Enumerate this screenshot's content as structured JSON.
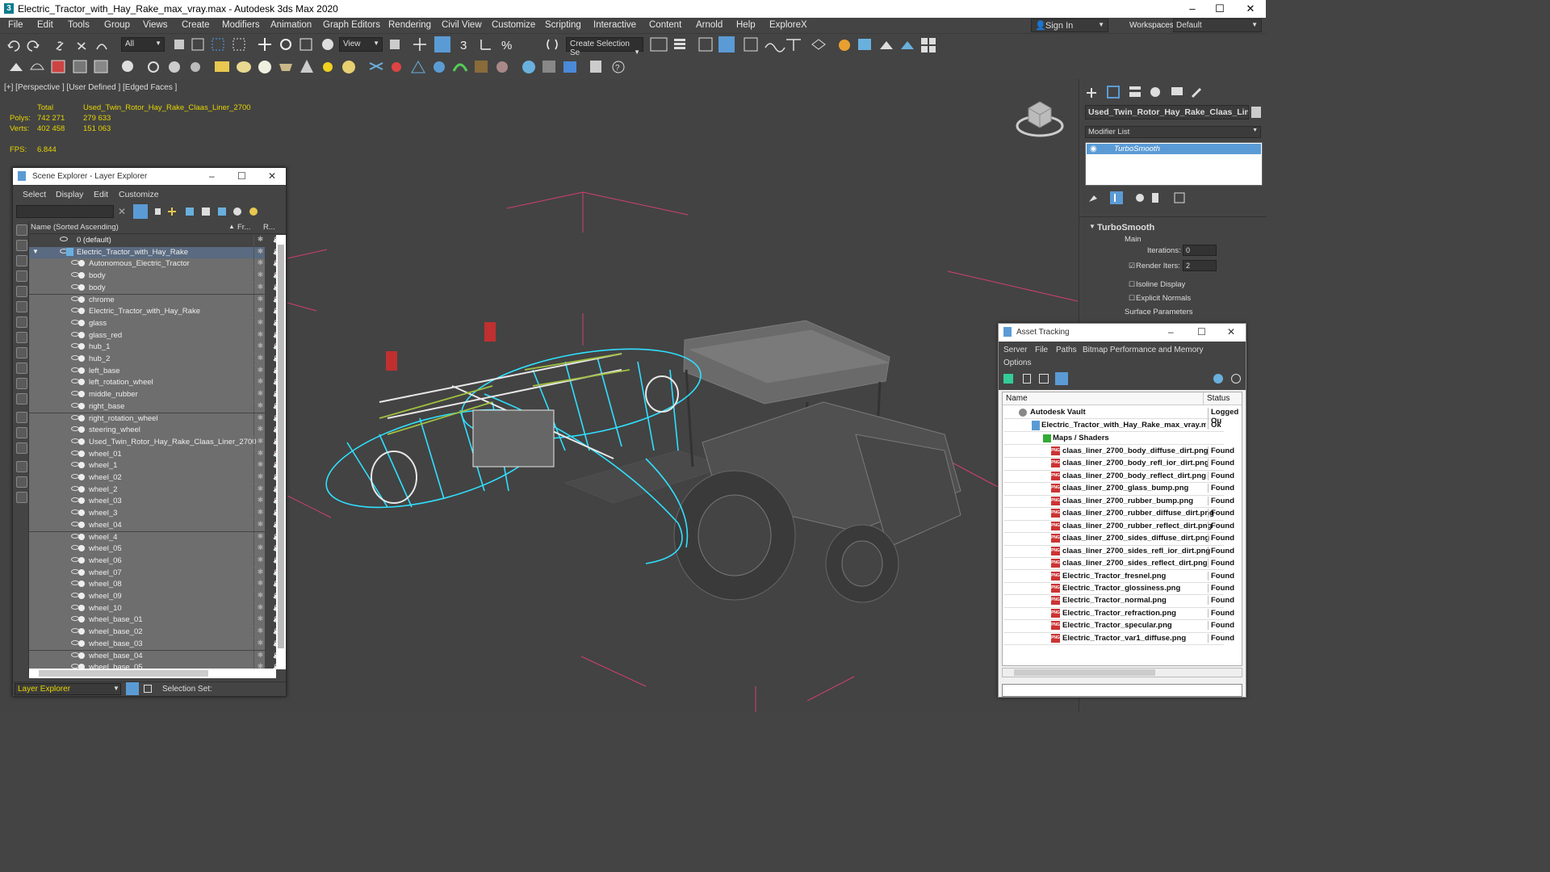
{
  "window": {
    "title": "Electric_Tractor_with_Hay_Rake_max_vray.max - Autodesk 3ds Max 2020",
    "icon": "3",
    "minimize": "–",
    "maximize": "☐",
    "close": "✕"
  },
  "menus": [
    "File",
    "Edit",
    "Tools",
    "Group",
    "Views",
    "Create",
    "Modifiers",
    "Animation",
    "Graph Editors",
    "Rendering",
    "Civil View",
    "Customize",
    "Scripting",
    "Interactive",
    "Content",
    "Arnold",
    "Help",
    "ExploreX"
  ],
  "signin": {
    "label": "Sign In",
    "workspaces_label": "Workspaces:",
    "workspace": "Default"
  },
  "toolbar": {
    "filter": "All",
    "view": "View",
    "create_selection": "Create Selection Se"
  },
  "viewport": {
    "label": "[+] [Perspective ] [User Defined ] [Edged Faces ]",
    "stats": {
      "total_label": "Total",
      "object": "Used_Twin_Rotor_Hay_Rake_Claas_Liner_2700",
      "polys_label": "Polys:",
      "polys_total": "742 271",
      "polys_obj": "279 633",
      "verts_label": "Verts:",
      "verts_total": "402 458",
      "verts_obj": "151 063",
      "fps_label": "FPS:",
      "fps": "6.844"
    }
  },
  "scene_explorer": {
    "title": "Scene Explorer - Layer Explorer",
    "menus": [
      "Select",
      "Display",
      "Edit",
      "Customize"
    ],
    "col_name": "Name (Sorted Ascending)",
    "col_fr": "Fr...",
    "col_r": "R...",
    "rows": [
      {
        "label": "0 (default)",
        "level": 0
      },
      {
        "label": "Electric_Tractor_with_Hay_Rake",
        "level": 0
      },
      {
        "label": "Autonomous_Electric_Tractor",
        "level": 1
      },
      {
        "label": "body",
        "level": 1
      },
      {
        "label": "body",
        "level": 1
      },
      {
        "label": "chrome",
        "level": 1
      },
      {
        "label": "Electric_Tractor_with_Hay_Rake",
        "level": 1
      },
      {
        "label": "glass",
        "level": 1
      },
      {
        "label": "glass_red",
        "level": 1
      },
      {
        "label": "hub_1",
        "level": 1
      },
      {
        "label": "hub_2",
        "level": 1
      },
      {
        "label": "left_base",
        "level": 1
      },
      {
        "label": "left_rotation_wheel",
        "level": 1
      },
      {
        "label": "middle_rubber",
        "level": 1
      },
      {
        "label": "right_base",
        "level": 1
      },
      {
        "label": "right_rotation_wheel",
        "level": 1
      },
      {
        "label": "steering_wheel",
        "level": 1
      },
      {
        "label": "Used_Twin_Rotor_Hay_Rake_Claas_Liner_2700",
        "level": 1
      },
      {
        "label": "wheel_01",
        "level": 1
      },
      {
        "label": "wheel_1",
        "level": 1
      },
      {
        "label": "wheel_02",
        "level": 1
      },
      {
        "label": "wheel_2",
        "level": 1
      },
      {
        "label": "wheel_03",
        "level": 1
      },
      {
        "label": "wheel_3",
        "level": 1
      },
      {
        "label": "wheel_04",
        "level": 1
      },
      {
        "label": "wheel_4",
        "level": 1
      },
      {
        "label": "wheel_05",
        "level": 1
      },
      {
        "label": "wheel_06",
        "level": 1
      },
      {
        "label": "wheel_07",
        "level": 1
      },
      {
        "label": "wheel_08",
        "level": 1
      },
      {
        "label": "wheel_09",
        "level": 1
      },
      {
        "label": "wheel_10",
        "level": 1
      },
      {
        "label": "wheel_base_01",
        "level": 1
      },
      {
        "label": "wheel_base_02",
        "level": 1
      },
      {
        "label": "wheel_base_03",
        "level": 1
      },
      {
        "label": "wheel_base_04",
        "level": 1
      },
      {
        "label": "wheel_base_05",
        "level": 1
      }
    ],
    "footer_layer": "Layer Explorer",
    "selection_set": "Selection Set:"
  },
  "command_panel": {
    "object_name": "Used_Twin_Rotor_Hay_Rake_Claas_Liner_",
    "modifier_list": "Modifier List",
    "modifier": "TurboSmooth",
    "rollout_title": "TurboSmooth",
    "main": "Main",
    "iterations_label": "Iterations:",
    "iterations": "0",
    "render_iters_label": "Render Iters:",
    "render_iters": "2",
    "isoline": "Isoline Display",
    "explicit": "Explicit Normals",
    "surface": "Surface Parameters"
  },
  "asset_tracking": {
    "title": "Asset Tracking",
    "menus": [
      "Server",
      "File",
      "Paths",
      "Bitmap Performance and Memory"
    ],
    "options": "Options",
    "col_name": "Name",
    "col_status": "Status",
    "vault": {
      "name": "Autodesk Vault",
      "status": "Logged Ou"
    },
    "file": {
      "name": "Electric_Tractor_with_Hay_Rake_max_vray.max",
      "status": "Ok"
    },
    "maps": "Maps / Shaders",
    "items": [
      {
        "name": "claas_liner_2700_body_diffuse_dirt.png",
        "status": "Found"
      },
      {
        "name": "claas_liner_2700_body_refl_ior_dirt.png",
        "status": "Found"
      },
      {
        "name": "claas_liner_2700_body_reflect_dirt.png",
        "status": "Found"
      },
      {
        "name": "claas_liner_2700_glass_bump.png",
        "status": "Found"
      },
      {
        "name": "claas_liner_2700_rubber_bump.png",
        "status": "Found"
      },
      {
        "name": "claas_liner_2700_rubber_diffuse_dirt.png",
        "status": "Found"
      },
      {
        "name": "claas_liner_2700_rubber_reflect_dirt.png",
        "status": "Found"
      },
      {
        "name": "claas_liner_2700_sides_diffuse_dirt.png",
        "status": "Found"
      },
      {
        "name": "claas_liner_2700_sides_refl_ior_dirt.png",
        "status": "Found"
      },
      {
        "name": "claas_liner_2700_sides_reflect_dirt.png",
        "status": "Found"
      },
      {
        "name": "Electric_Tractor_fresnel.png",
        "status": "Found"
      },
      {
        "name": "Electric_Tractor_glossiness.png",
        "status": "Found"
      },
      {
        "name": "Electric_Tractor_normal.png",
        "status": "Found"
      },
      {
        "name": "Electric_Tractor_refraction.png",
        "status": "Found"
      },
      {
        "name": "Electric_Tractor_specular.png",
        "status": "Found"
      },
      {
        "name": "Electric_Tractor_var1_diffuse.png",
        "status": "Found"
      }
    ]
  }
}
